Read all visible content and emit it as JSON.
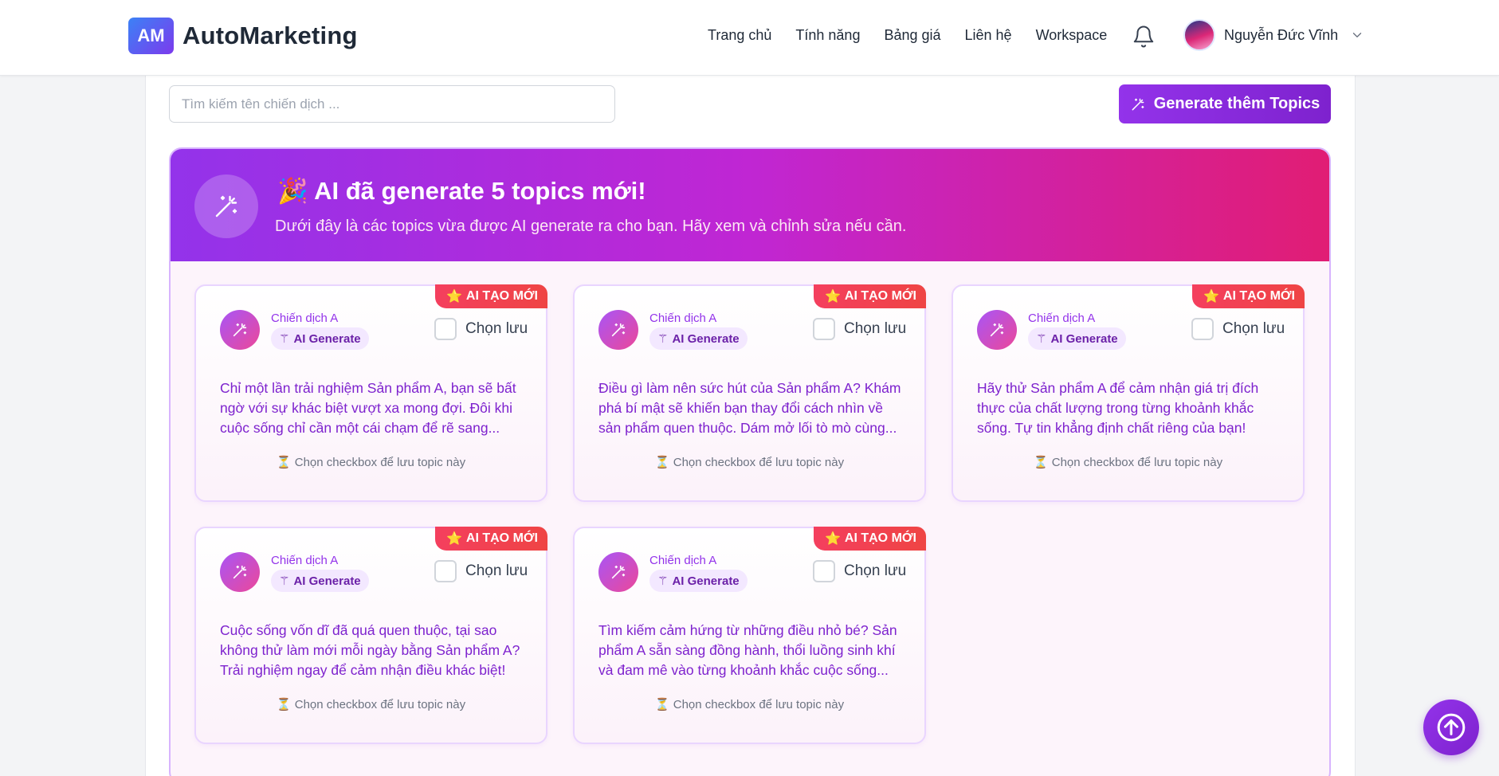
{
  "header": {
    "logo_badge": "AM",
    "logo_text": "AutoMarketing",
    "nav": [
      "Trang chủ",
      "Tính năng",
      "Bảng giá",
      "Liên hệ",
      "Workspace"
    ],
    "user_name": "Nguyễn Đức Vĩnh"
  },
  "toolbar": {
    "search_placeholder": "Tìm kiếm tên chiến dịch ...",
    "generate_label": "Generate thêm Topics"
  },
  "banner": {
    "emoji": "🎉",
    "title": "AI đã generate 5 topics mới!",
    "subtitle": "Dưới đây là các topics vừa được AI generate ra cho bạn. Hãy xem và chỉnh sửa nếu cần."
  },
  "cards": [
    {
      "badge": "AI TẠO MỚI",
      "campaign": "Chiến dịch A",
      "tag": "AI Generate",
      "save_label": "Chọn lưu",
      "text": "Chỉ một lần trải nghiệm Sản phẩm A, bạn sẽ bất ngờ với sự khác biệt vượt xa mong đợi. Đôi khi cuộc sống chỉ cần một cái chạm để rẽ sang...",
      "hint": "⏳ Chọn checkbox để lưu topic này"
    },
    {
      "badge": "AI TẠO MỚI",
      "campaign": "Chiến dịch A",
      "tag": "AI Generate",
      "save_label": "Chọn lưu",
      "text": "Điều gì làm nên sức hút của Sản phẩm A? Khám phá bí mật sẽ khiến bạn thay đổi cách nhìn về sản phẩm quen thuộc. Dám mở lối tò mò cùng...",
      "hint": "⏳ Chọn checkbox để lưu topic này"
    },
    {
      "badge": "AI TẠO MỚI",
      "campaign": "Chiến dịch A",
      "tag": "AI Generate",
      "save_label": "Chọn lưu",
      "text": "Hãy thử Sản phẩm A để cảm nhận giá trị đích thực của chất lượng trong từng khoảnh khắc sống. Tự tin khẳng định chất riêng của bạn!",
      "hint": "⏳ Chọn checkbox để lưu topic này"
    },
    {
      "badge": "AI TẠO MỚI",
      "campaign": "Chiến dịch A",
      "tag": "AI Generate",
      "save_label": "Chọn lưu",
      "text": "Cuộc sống vốn dĩ đã quá quen thuộc, tại sao không thử làm mới mỗi ngày bằng Sản phẩm A? Trải nghiệm ngay để cảm nhận điều khác biệt!",
      "hint": "⏳ Chọn checkbox để lưu topic này"
    },
    {
      "badge": "AI TẠO MỚI",
      "campaign": "Chiến dịch A",
      "tag": "AI Generate",
      "save_label": "Chọn lưu",
      "text": "Tìm kiếm cảm hứng từ những điều nhỏ bé? Sản phẩm A sẵn sàng đồng hành, thổi luồng sinh khí và đam mê vào từng khoảnh khắc cuộc sống...",
      "hint": "⏳ Chọn checkbox để lưu topic này"
    }
  ]
}
